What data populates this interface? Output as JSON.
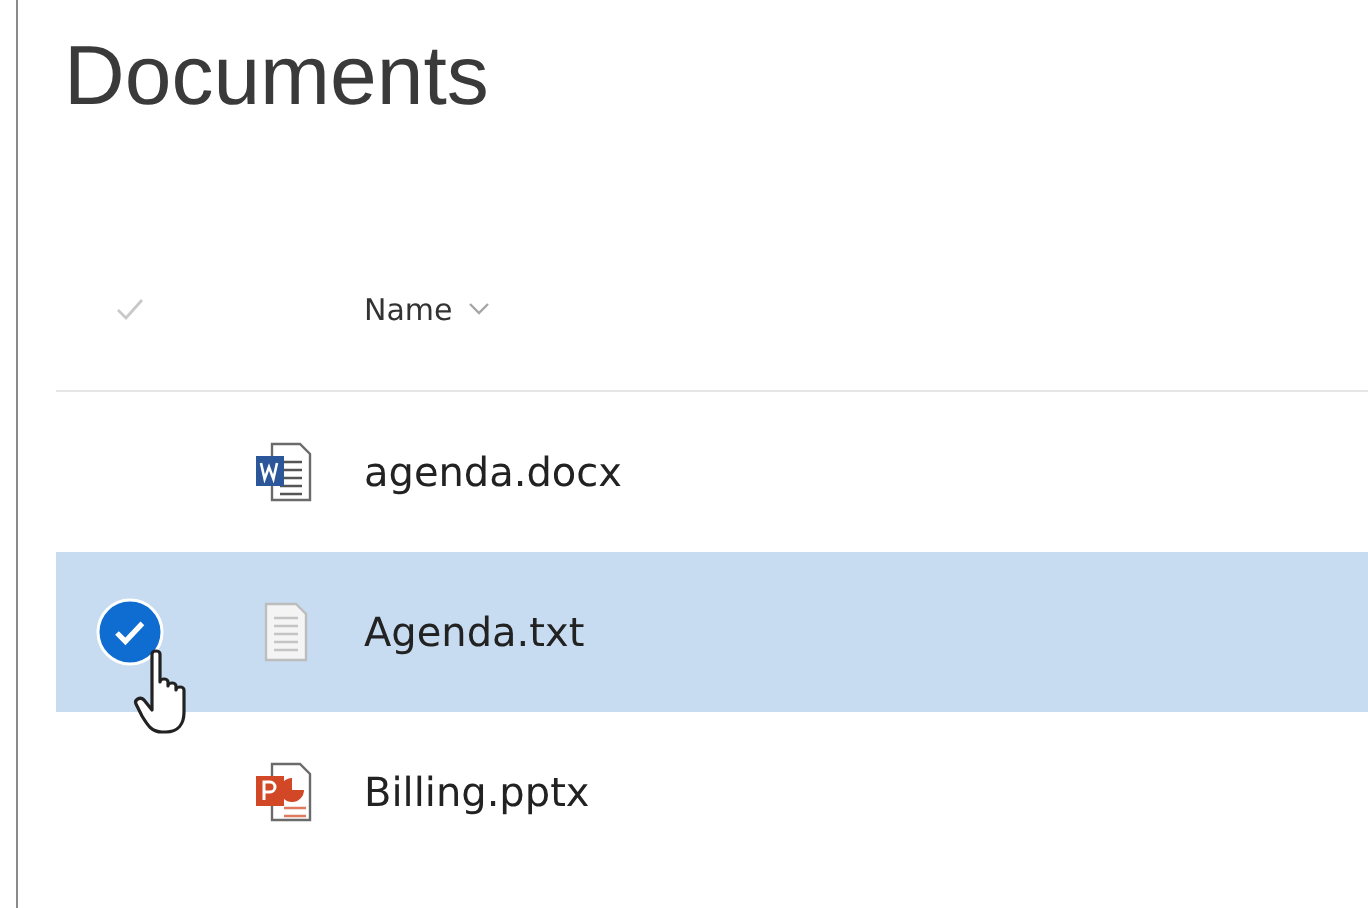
{
  "title": "Documents",
  "columns": [
    {
      "label": "Name"
    }
  ],
  "rows": [
    {
      "name": "agenda.docx",
      "kind": "word",
      "selected": false
    },
    {
      "name": "Agenda.txt",
      "kind": "text",
      "selected": true
    },
    {
      "name": "Billing.pptx",
      "kind": "powerpoint",
      "selected": false
    }
  ]
}
